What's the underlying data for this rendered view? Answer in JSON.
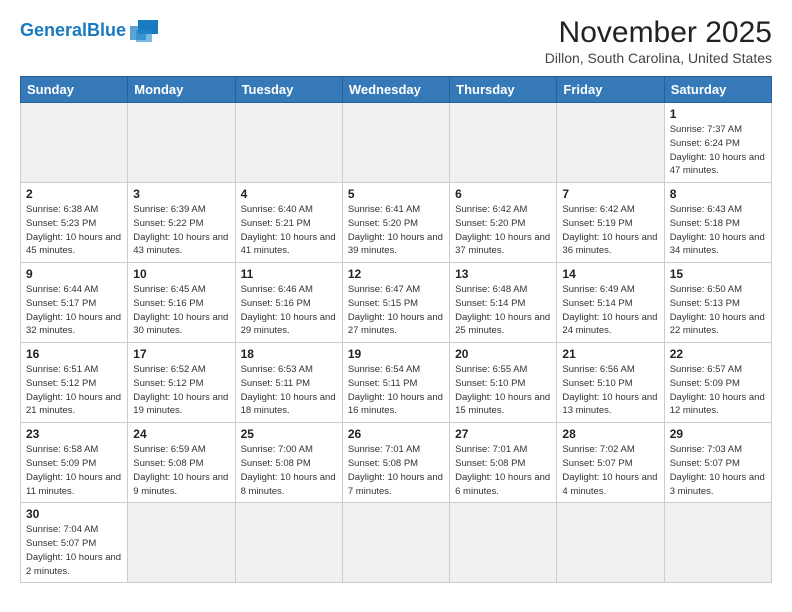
{
  "header": {
    "logo_text_normal": "General",
    "logo_text_bold": "Blue",
    "month_title": "November 2025",
    "location": "Dillon, South Carolina, United States"
  },
  "weekdays": [
    "Sunday",
    "Monday",
    "Tuesday",
    "Wednesday",
    "Thursday",
    "Friday",
    "Saturday"
  ],
  "weeks": [
    [
      {
        "day": "",
        "info": ""
      },
      {
        "day": "",
        "info": ""
      },
      {
        "day": "",
        "info": ""
      },
      {
        "day": "",
        "info": ""
      },
      {
        "day": "",
        "info": ""
      },
      {
        "day": "",
        "info": ""
      },
      {
        "day": "1",
        "info": "Sunrise: 7:37 AM\nSunset: 6:24 PM\nDaylight: 10 hours and 47 minutes."
      }
    ],
    [
      {
        "day": "2",
        "info": "Sunrise: 6:38 AM\nSunset: 5:23 PM\nDaylight: 10 hours and 45 minutes."
      },
      {
        "day": "3",
        "info": "Sunrise: 6:39 AM\nSunset: 5:22 PM\nDaylight: 10 hours and 43 minutes."
      },
      {
        "day": "4",
        "info": "Sunrise: 6:40 AM\nSunset: 5:21 PM\nDaylight: 10 hours and 41 minutes."
      },
      {
        "day": "5",
        "info": "Sunrise: 6:41 AM\nSunset: 5:20 PM\nDaylight: 10 hours and 39 minutes."
      },
      {
        "day": "6",
        "info": "Sunrise: 6:42 AM\nSunset: 5:20 PM\nDaylight: 10 hours and 37 minutes."
      },
      {
        "day": "7",
        "info": "Sunrise: 6:42 AM\nSunset: 5:19 PM\nDaylight: 10 hours and 36 minutes."
      },
      {
        "day": "8",
        "info": "Sunrise: 6:43 AM\nSunset: 5:18 PM\nDaylight: 10 hours and 34 minutes."
      }
    ],
    [
      {
        "day": "9",
        "info": "Sunrise: 6:44 AM\nSunset: 5:17 PM\nDaylight: 10 hours and 32 minutes."
      },
      {
        "day": "10",
        "info": "Sunrise: 6:45 AM\nSunset: 5:16 PM\nDaylight: 10 hours and 30 minutes."
      },
      {
        "day": "11",
        "info": "Sunrise: 6:46 AM\nSunset: 5:16 PM\nDaylight: 10 hours and 29 minutes."
      },
      {
        "day": "12",
        "info": "Sunrise: 6:47 AM\nSunset: 5:15 PM\nDaylight: 10 hours and 27 minutes."
      },
      {
        "day": "13",
        "info": "Sunrise: 6:48 AM\nSunset: 5:14 PM\nDaylight: 10 hours and 25 minutes."
      },
      {
        "day": "14",
        "info": "Sunrise: 6:49 AM\nSunset: 5:14 PM\nDaylight: 10 hours and 24 minutes."
      },
      {
        "day": "15",
        "info": "Sunrise: 6:50 AM\nSunset: 5:13 PM\nDaylight: 10 hours and 22 minutes."
      }
    ],
    [
      {
        "day": "16",
        "info": "Sunrise: 6:51 AM\nSunset: 5:12 PM\nDaylight: 10 hours and 21 minutes."
      },
      {
        "day": "17",
        "info": "Sunrise: 6:52 AM\nSunset: 5:12 PM\nDaylight: 10 hours and 19 minutes."
      },
      {
        "day": "18",
        "info": "Sunrise: 6:53 AM\nSunset: 5:11 PM\nDaylight: 10 hours and 18 minutes."
      },
      {
        "day": "19",
        "info": "Sunrise: 6:54 AM\nSunset: 5:11 PM\nDaylight: 10 hours and 16 minutes."
      },
      {
        "day": "20",
        "info": "Sunrise: 6:55 AM\nSunset: 5:10 PM\nDaylight: 10 hours and 15 minutes."
      },
      {
        "day": "21",
        "info": "Sunrise: 6:56 AM\nSunset: 5:10 PM\nDaylight: 10 hours and 13 minutes."
      },
      {
        "day": "22",
        "info": "Sunrise: 6:57 AM\nSunset: 5:09 PM\nDaylight: 10 hours and 12 minutes."
      }
    ],
    [
      {
        "day": "23",
        "info": "Sunrise: 6:58 AM\nSunset: 5:09 PM\nDaylight: 10 hours and 11 minutes."
      },
      {
        "day": "24",
        "info": "Sunrise: 6:59 AM\nSunset: 5:08 PM\nDaylight: 10 hours and 9 minutes."
      },
      {
        "day": "25",
        "info": "Sunrise: 7:00 AM\nSunset: 5:08 PM\nDaylight: 10 hours and 8 minutes."
      },
      {
        "day": "26",
        "info": "Sunrise: 7:01 AM\nSunset: 5:08 PM\nDaylight: 10 hours and 7 minutes."
      },
      {
        "day": "27",
        "info": "Sunrise: 7:01 AM\nSunset: 5:08 PM\nDaylight: 10 hours and 6 minutes."
      },
      {
        "day": "28",
        "info": "Sunrise: 7:02 AM\nSunset: 5:07 PM\nDaylight: 10 hours and 4 minutes."
      },
      {
        "day": "29",
        "info": "Sunrise: 7:03 AM\nSunset: 5:07 PM\nDaylight: 10 hours and 3 minutes."
      }
    ],
    [
      {
        "day": "30",
        "info": "Sunrise: 7:04 AM\nSunset: 5:07 PM\nDaylight: 10 hours and 2 minutes."
      },
      {
        "day": "",
        "info": ""
      },
      {
        "day": "",
        "info": ""
      },
      {
        "day": "",
        "info": ""
      },
      {
        "day": "",
        "info": ""
      },
      {
        "day": "",
        "info": ""
      },
      {
        "day": "",
        "info": ""
      }
    ]
  ]
}
